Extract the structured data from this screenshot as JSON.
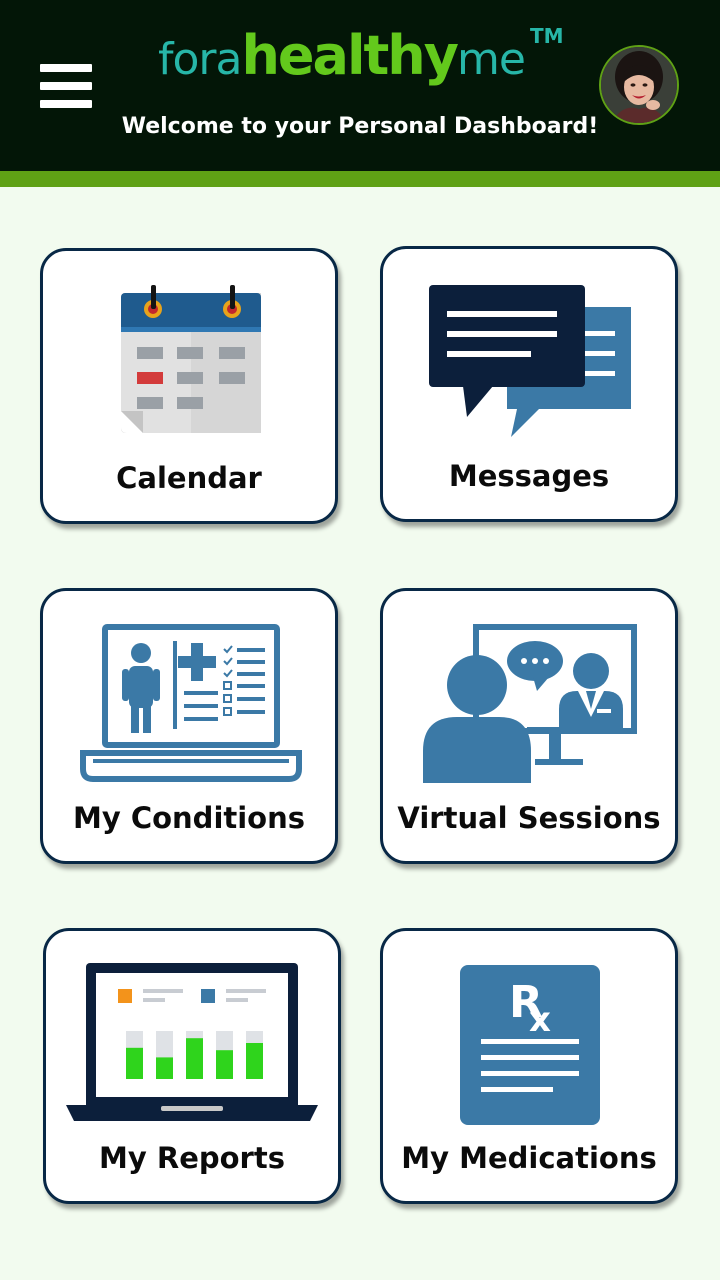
{
  "header": {
    "logo": {
      "part1": "fora",
      "part2": "healthy",
      "part3": "me",
      "trademark": "TM"
    },
    "welcome_text": "Welcome to your Personal Dashboard!",
    "menu_icon": "hamburger-menu-icon",
    "avatar": "user-avatar"
  },
  "colors": {
    "header_bg": "#031607",
    "accent_green": "#5fa115",
    "logo_teal": "#27b6a8",
    "logo_green": "#63c91c",
    "tile_border": "#082846",
    "icon_blue": "#3b79a6",
    "icon_navy": "#0c1f3b",
    "page_bg": "#f2fbef"
  },
  "tiles": [
    {
      "label": "Calendar",
      "icon": "calendar-icon"
    },
    {
      "label": "Messages",
      "icon": "chat-bubbles-icon"
    },
    {
      "label": "My Conditions",
      "icon": "medical-record-laptop-icon"
    },
    {
      "label": "Virtual Sessions",
      "icon": "video-consultation-icon"
    },
    {
      "label": "My Reports",
      "icon": "bar-chart-laptop-icon"
    },
    {
      "label": "My Medications",
      "icon": "prescription-rx-icon"
    }
  ],
  "reports_chart": {
    "levels": [
      0.65,
      0.45,
      0.85,
      0.6,
      0.75
    ]
  }
}
